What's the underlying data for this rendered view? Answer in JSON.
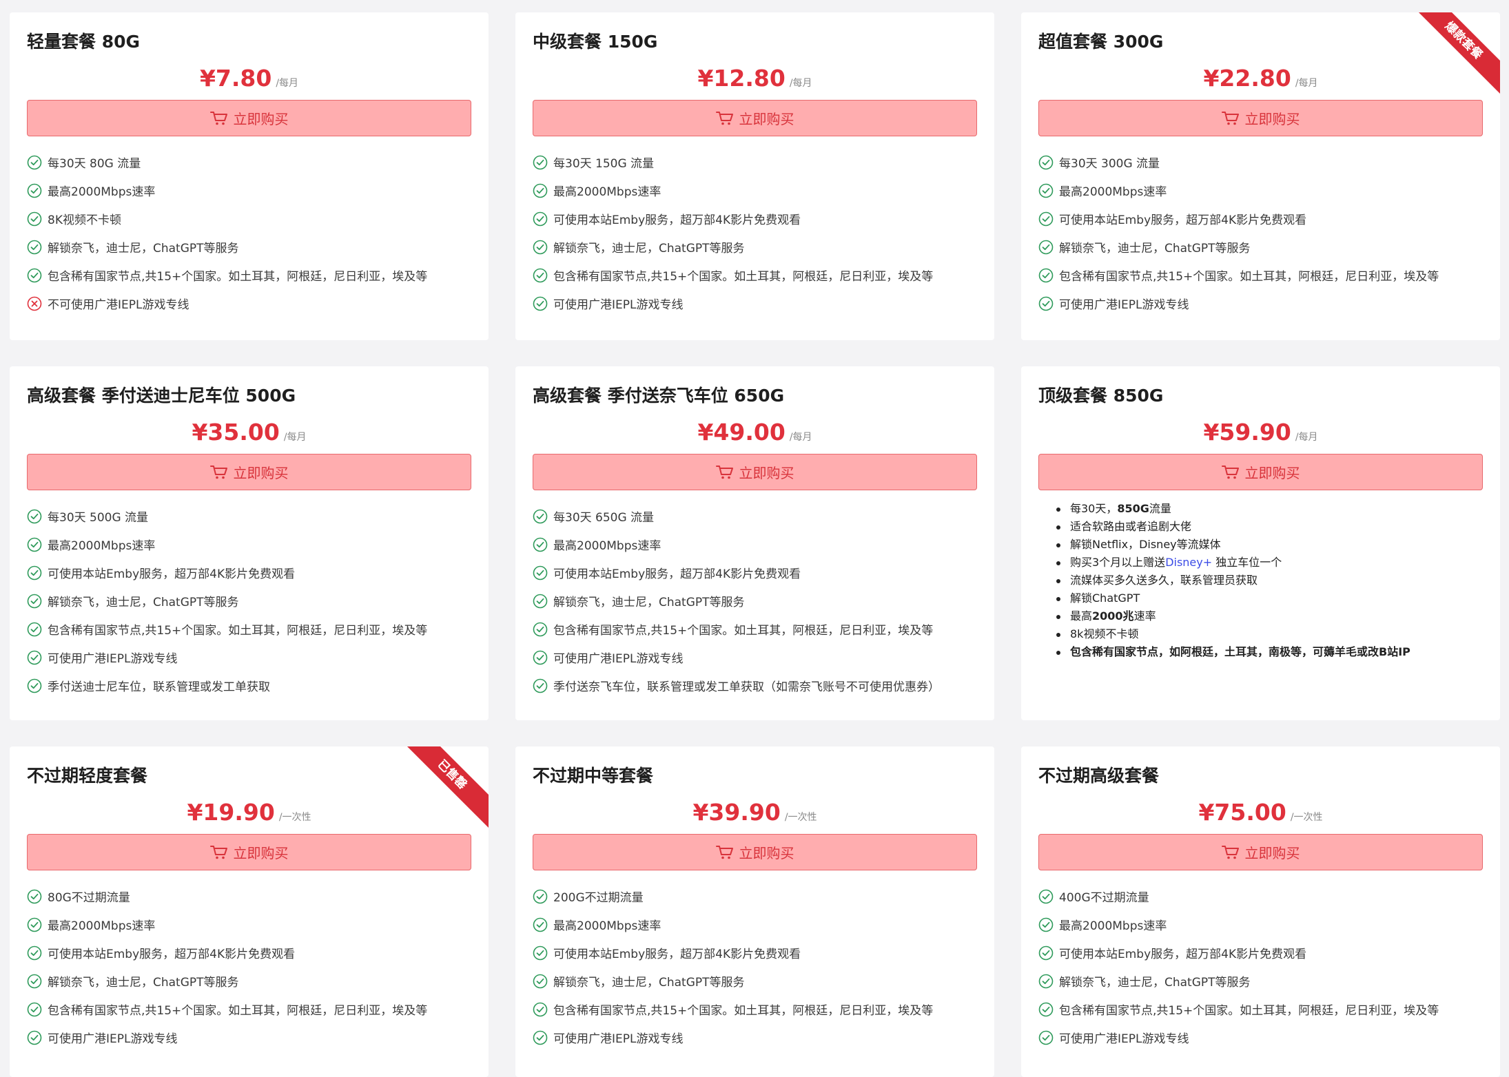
{
  "common": {
    "buy_label": "立即购买"
  },
  "plans": [
    {
      "title": "轻量套餐 80G",
      "price": "¥7.80",
      "period": "/每月",
      "ribbon": "",
      "features": [
        {
          "ok": true,
          "text": "每30天 80G 流量"
        },
        {
          "ok": true,
          "text": "最高2000Mbps速率"
        },
        {
          "ok": true,
          "text": "8K视频不卡顿"
        },
        {
          "ok": true,
          "text": "解锁奈飞，迪士尼，ChatGPT等服务"
        },
        {
          "ok": true,
          "text": "包含稀有国家节点,共15+个国家。如土耳其，阿根廷，尼日利亚，埃及等"
        },
        {
          "ok": false,
          "text": "不可使用广港IEPL游戏专线"
        }
      ]
    },
    {
      "title": "中级套餐 150G",
      "price": "¥12.80",
      "period": "/每月",
      "ribbon": "",
      "features": [
        {
          "ok": true,
          "text": "每30天 150G 流量"
        },
        {
          "ok": true,
          "text": "最高2000Mbps速率"
        },
        {
          "ok": true,
          "text": "可使用本站Emby服务，超万部4K影片免费观看"
        },
        {
          "ok": true,
          "text": "解锁奈飞，迪士尼，ChatGPT等服务"
        },
        {
          "ok": true,
          "text": "包含稀有国家节点,共15+个国家。如土耳其，阿根廷，尼日利亚，埃及等"
        },
        {
          "ok": true,
          "text": "可使用广港IEPL游戏专线"
        }
      ]
    },
    {
      "title": "超值套餐 300G",
      "price": "¥22.80",
      "period": "/每月",
      "ribbon": "爆款套餐",
      "features": [
        {
          "ok": true,
          "text": "每30天 300G 流量"
        },
        {
          "ok": true,
          "text": "最高2000Mbps速率"
        },
        {
          "ok": true,
          "text": "可使用本站Emby服务，超万部4K影片免费观看"
        },
        {
          "ok": true,
          "text": "解锁奈飞，迪士尼，ChatGPT等服务"
        },
        {
          "ok": true,
          "text": "包含稀有国家节点,共15+个国家。如土耳其，阿根廷，尼日利亚，埃及等"
        },
        {
          "ok": true,
          "text": "可使用广港IEPL游戏专线"
        }
      ]
    },
    {
      "title": "高级套餐 季付送迪士尼车位 500G",
      "price": "¥35.00",
      "period": "/每月",
      "ribbon": "",
      "features": [
        {
          "ok": true,
          "text": "每30天 500G 流量"
        },
        {
          "ok": true,
          "text": "最高2000Mbps速率"
        },
        {
          "ok": true,
          "text": "可使用本站Emby服务，超万部4K影片免费观看"
        },
        {
          "ok": true,
          "text": "解锁奈飞，迪士尼，ChatGPT等服务"
        },
        {
          "ok": true,
          "text": "包含稀有国家节点,共15+个国家。如土耳其，阿根廷，尼日利亚，埃及等"
        },
        {
          "ok": true,
          "text": "可使用广港IEPL游戏专线"
        },
        {
          "ok": true,
          "text": "季付送迪士尼车位，联系管理或发工单获取"
        }
      ]
    },
    {
      "title": "高级套餐 季付送奈飞车位 650G",
      "price": "¥49.00",
      "period": "/每月",
      "ribbon": "",
      "features": [
        {
          "ok": true,
          "text": "每30天 650G 流量"
        },
        {
          "ok": true,
          "text": "最高2000Mbps速率"
        },
        {
          "ok": true,
          "text": "可使用本站Emby服务，超万部4K影片免费观看"
        },
        {
          "ok": true,
          "text": "解锁奈飞，迪士尼，ChatGPT等服务"
        },
        {
          "ok": true,
          "text": "包含稀有国家节点,共15+个国家。如土耳其，阿根廷，尼日利亚，埃及等"
        },
        {
          "ok": true,
          "text": "可使用广港IEPL游戏专线"
        },
        {
          "ok": true,
          "text": "季付送奈飞车位，联系管理或发工单获取（如需奈飞账号不可使用优惠券）"
        }
      ]
    },
    {
      "title": "顶级套餐 850G",
      "price": "¥59.90",
      "period": "/每月",
      "ribbon": "",
      "bullets": [
        {
          "pre": "每30天，",
          "bold": "850G",
          "post": "流量"
        },
        {
          "pre": "适合软路由或者追剧大佬"
        },
        {
          "pre": "解锁Netflix，Disney等流媒体"
        },
        {
          "pre": "购买3个月以上赠送",
          "link": "Disney+",
          "post": " 独立车位一个"
        },
        {
          "pre": "流媒体买多久送多久，联系管理员获取"
        },
        {
          "pre": "解锁ChatGPT"
        },
        {
          "pre": "最高",
          "bold": "2000兆",
          "post": "速率"
        },
        {
          "pre": "8k视频不卡顿"
        },
        {
          "bold": "包含稀有国家节点，如阿根廷，土耳其，南极等，可薅羊毛或改B站IP"
        }
      ]
    },
    {
      "title": "不过期轻度套餐",
      "price": "¥19.90",
      "period": "/一次性",
      "ribbon": "已售罄",
      "features": [
        {
          "ok": true,
          "text": "80G不过期流量"
        },
        {
          "ok": true,
          "text": "最高2000Mbps速率"
        },
        {
          "ok": true,
          "text": "可使用本站Emby服务，超万部4K影片免费观看"
        },
        {
          "ok": true,
          "text": "解锁奈飞，迪士尼，ChatGPT等服务"
        },
        {
          "ok": true,
          "text": "包含稀有国家节点,共15+个国家。如土耳其，阿根廷，尼日利亚，埃及等"
        },
        {
          "ok": true,
          "text": "可使用广港IEPL游戏专线"
        }
      ]
    },
    {
      "title": "不过期中等套餐",
      "price": "¥39.90",
      "period": "/一次性",
      "ribbon": "",
      "features": [
        {
          "ok": true,
          "text": "200G不过期流量"
        },
        {
          "ok": true,
          "text": "最高2000Mbps速率"
        },
        {
          "ok": true,
          "text": "可使用本站Emby服务，超万部4K影片免费观看"
        },
        {
          "ok": true,
          "text": "解锁奈飞，迪士尼，ChatGPT等服务"
        },
        {
          "ok": true,
          "text": "包含稀有国家节点,共15+个国家。如土耳其，阿根廷，尼日利亚，埃及等"
        },
        {
          "ok": true,
          "text": "可使用广港IEPL游戏专线"
        }
      ]
    },
    {
      "title": "不过期高级套餐",
      "price": "¥75.00",
      "period": "/一次性",
      "ribbon": "",
      "features": [
        {
          "ok": true,
          "text": "400G不过期流量"
        },
        {
          "ok": true,
          "text": "最高2000Mbps速率"
        },
        {
          "ok": true,
          "text": "可使用本站Emby服务，超万部4K影片免费观看"
        },
        {
          "ok": true,
          "text": "解锁奈飞，迪士尼，ChatGPT等服务"
        },
        {
          "ok": true,
          "text": "包含稀有国家节点,共15+个国家。如土耳其，阿根廷，尼日利亚，埃及等"
        },
        {
          "ok": true,
          "text": "可使用广港IEPL游戏专线"
        }
      ]
    }
  ],
  "colors": {
    "accent": "#e0313c",
    "button_bg": "#ffadaf",
    "check": "#2e9a5a",
    "cross": "#e0313c"
  }
}
